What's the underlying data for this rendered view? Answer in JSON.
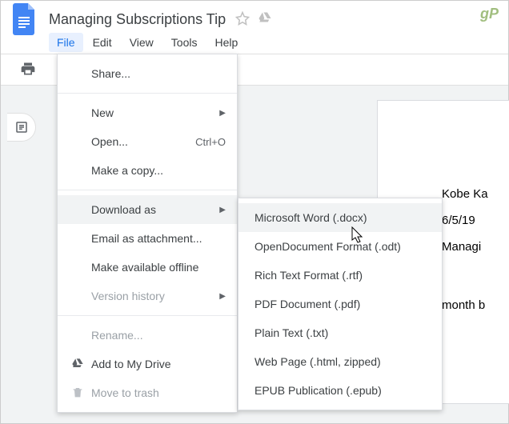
{
  "doc": {
    "title": "Managing Subscriptions Tip"
  },
  "menubar": {
    "file": "File",
    "edit": "Edit",
    "view": "View",
    "tools": "Tools",
    "help": "Help"
  },
  "file_menu": {
    "share": "Share...",
    "new": "New",
    "open": "Open...",
    "open_shortcut": "Ctrl+O",
    "make_copy": "Make a copy...",
    "download_as": "Download as",
    "email_attachment": "Email as attachment...",
    "make_offline": "Make available offline",
    "version_history": "Version history",
    "rename": "Rename...",
    "add_to_drive": "Add to My Drive",
    "move_to_trash": "Move to trash"
  },
  "download_submenu": {
    "docx": "Microsoft Word (.docx)",
    "odt": "OpenDocument Format (.odt)",
    "rtf": "Rich Text Format (.rtf)",
    "pdf": "PDF Document (.pdf)",
    "txt": "Plain Text (.txt)",
    "html": "Web Page (.html, zipped)",
    "epub": "EPUB Publication (.epub)"
  },
  "document_body": {
    "line1": "Kobe Ka",
    "line2": "6/5/19",
    "line3": "Managi",
    "line4": "month b"
  },
  "watermark": "gP"
}
